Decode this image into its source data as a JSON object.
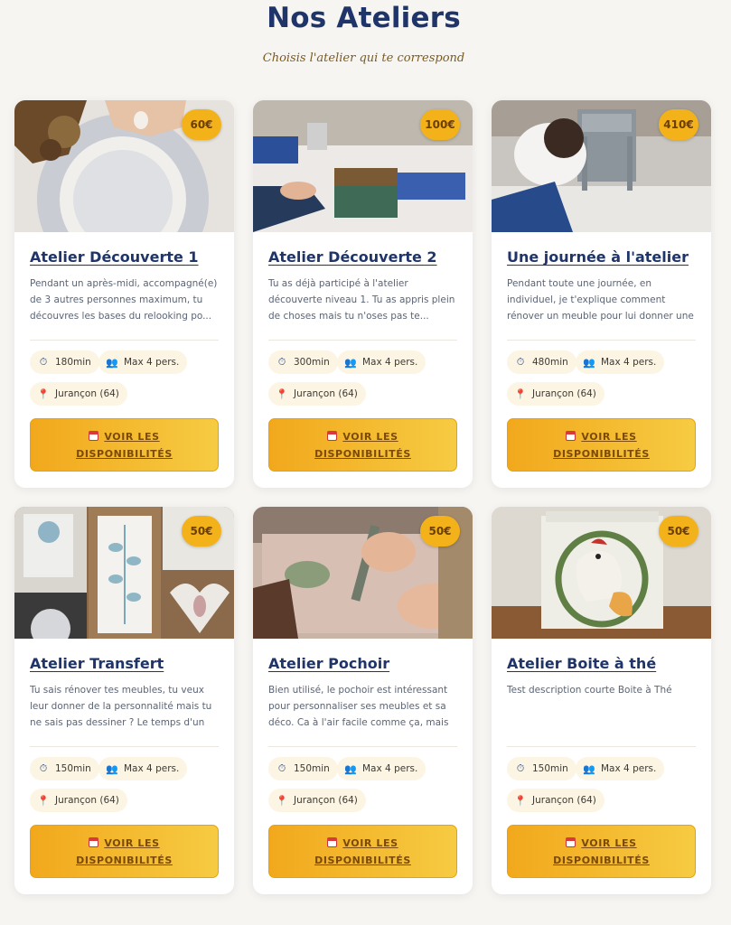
{
  "header": {
    "title": "Nos Ateliers",
    "subtitle": "Choisis l'atelier qui te correspond"
  },
  "colors": {
    "title": "#1f3569",
    "accent": "#f3b21a",
    "cta_gradient_start": "#f2a81c",
    "cta_gradient_end": "#f6cb42",
    "chip_bg": "#fdf5e4"
  },
  "icons": {
    "duration": "stopwatch-icon",
    "capacity": "people-icon",
    "location": "pin-icon",
    "cta": "calendar-icon"
  },
  "cards": [
    {
      "price": "60€",
      "title": "Atelier Découverte 1",
      "description": "Pendant un après-midi, accompagné(e) de 3 autres personnes maximum, tu découvres les bases du relooking po...",
      "duration": "180min",
      "capacity": "Max 4 pers.",
      "location": "Jurançon (64)",
      "cta_line1": "VOIR LES",
      "cta_line2": "DISPONIBILITÉS"
    },
    {
      "price": "100€",
      "title": "Atelier Découverte 2",
      "description": "Tu as déjà participé à l'atelier découverte niveau 1. Tu as appris plein de choses mais tu n'oses pas te...",
      "duration": "300min",
      "capacity": "Max 4 pers.",
      "location": "Jurançon (64)",
      "cta_line1": "VOIR LES",
      "cta_line2": "DISPONIBILITÉS"
    },
    {
      "price": "410€",
      "title": "Une journée à l'atelier",
      "description": "Pendant toute une journée, en individuel, je t'explique comment rénover un meuble pour lui donner une seconde vi...",
      "duration": "480min",
      "capacity": "Max 4 pers.",
      "location": "Jurançon (64)",
      "cta_line1": "VOIR LES",
      "cta_line2": "DISPONIBILITÉS"
    },
    {
      "price": "50€",
      "title": "Atelier Transfert",
      "description": "Tu sais rénover tes meubles, tu veux leur donner de la personnalité mais tu ne sais pas dessiner ? Le temps d'un après-mid...",
      "duration": "150min",
      "capacity": "Max 4 pers.",
      "location": "Jurançon (64)",
      "cta_line1": "VOIR LES",
      "cta_line2": "DISPONIBILITÉS"
    },
    {
      "price": "50€",
      "title": "Atelier Pochoir",
      "description": "Bien utilisé, le pochoir est intéressant pour personnaliser ses meubles et sa déco. Ca à l'air facile comme ça, mais p...",
      "duration": "150min",
      "capacity": "Max 4 pers.",
      "location": "Jurançon (64)",
      "cta_line1": "VOIR LES",
      "cta_line2": "DISPONIBILITÉS"
    },
    {
      "price": "50€",
      "title": "Atelier Boite à thé",
      "description": "Test description courte Boite à Thé",
      "duration": "150min",
      "capacity": "Max 4 pers.",
      "location": "Jurançon (64)",
      "cta_line1": "VOIR LES",
      "cta_line2": "DISPONIBILITÉS"
    }
  ]
}
